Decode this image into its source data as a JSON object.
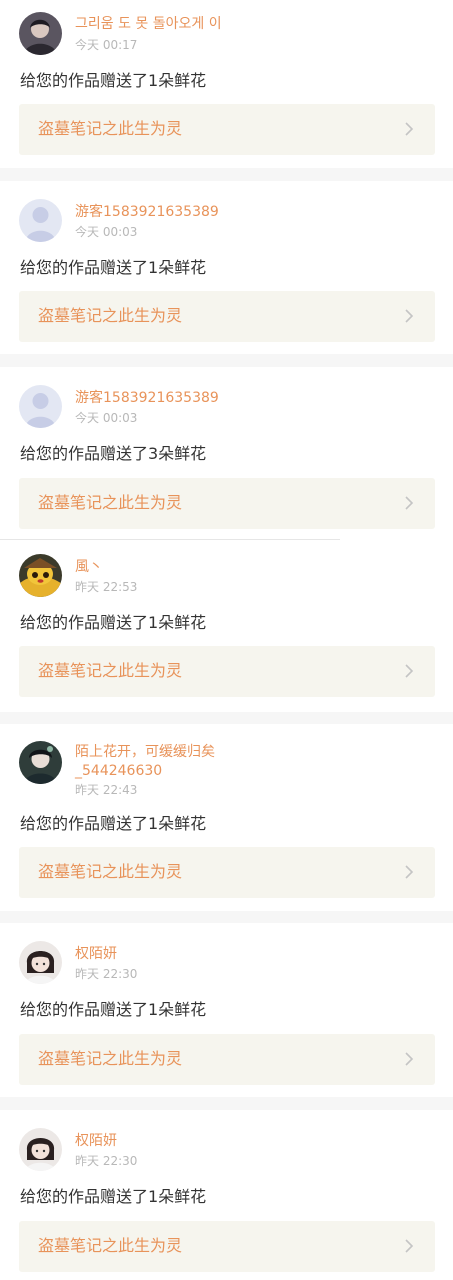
{
  "notifications": [
    {
      "name": "그리움 도 못 돌아오게 이",
      "time": "今天 00:17",
      "message": "给您的作品赠送了1朵鲜花",
      "work": "盗墓笔记之此生为灵",
      "avatar": "dark-photo-avatar"
    },
    {
      "name": "游客1583921635389",
      "time": "今天 00:03",
      "message": "给您的作品赠送了1朵鲜花",
      "work": "盗墓笔记之此生为灵",
      "avatar": "default-user-avatar"
    },
    {
      "name": "游客1583921635389",
      "time": "今天 00:03",
      "message": "给您的作品赠送了3朵鲜花",
      "work": "盗墓笔记之此生为灵",
      "avatar": "default-user-avatar"
    },
    {
      "name": "風丶",
      "time": "昨天 22:53",
      "message": "给您的作品赠送了1朵鲜花",
      "work": "盗墓笔记之此生为灵",
      "avatar": "cartoon-detective-avatar"
    },
    {
      "name_line1": "陌上花开，可缓缓归矣",
      "name_line2": "_544246630",
      "time": "昨天 22:43",
      "message": "给您的作品赠送了1朵鲜花",
      "work": "盗墓笔记之此生为灵",
      "avatar": "anime-character-avatar"
    },
    {
      "name": "权陌妍",
      "time": "昨天 22:30",
      "message": "给您的作品赠送了1朵鲜花",
      "work": "盗墓笔记之此生为灵",
      "avatar": "girl-photo-avatar"
    },
    {
      "name": "权陌妍",
      "time": "昨天 22:30",
      "message": "给您的作品赠送了1朵鲜花",
      "work": "盗墓笔记之此生为灵",
      "avatar": "girl-photo-avatar"
    }
  ],
  "colors": {
    "accent": "#e8935a",
    "work_bg": "#f6f5ee",
    "page_bg": "#f6f6f6",
    "text": "#333333",
    "muted": "#b8b8b8"
  },
  "icons": {
    "chevron": "chevron-right-icon"
  }
}
